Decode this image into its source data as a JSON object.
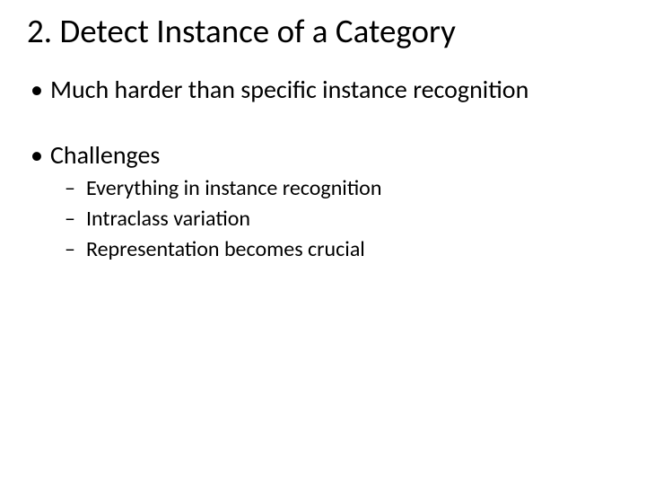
{
  "title": "2. Detect Instance of a Category",
  "bullets": [
    {
      "text": "Much harder than specific instance recognition",
      "sub": []
    },
    {
      "text": "Challenges",
      "sub": [
        "Everything in instance recognition",
        "Intraclass variation",
        "Representation becomes crucial"
      ]
    }
  ]
}
